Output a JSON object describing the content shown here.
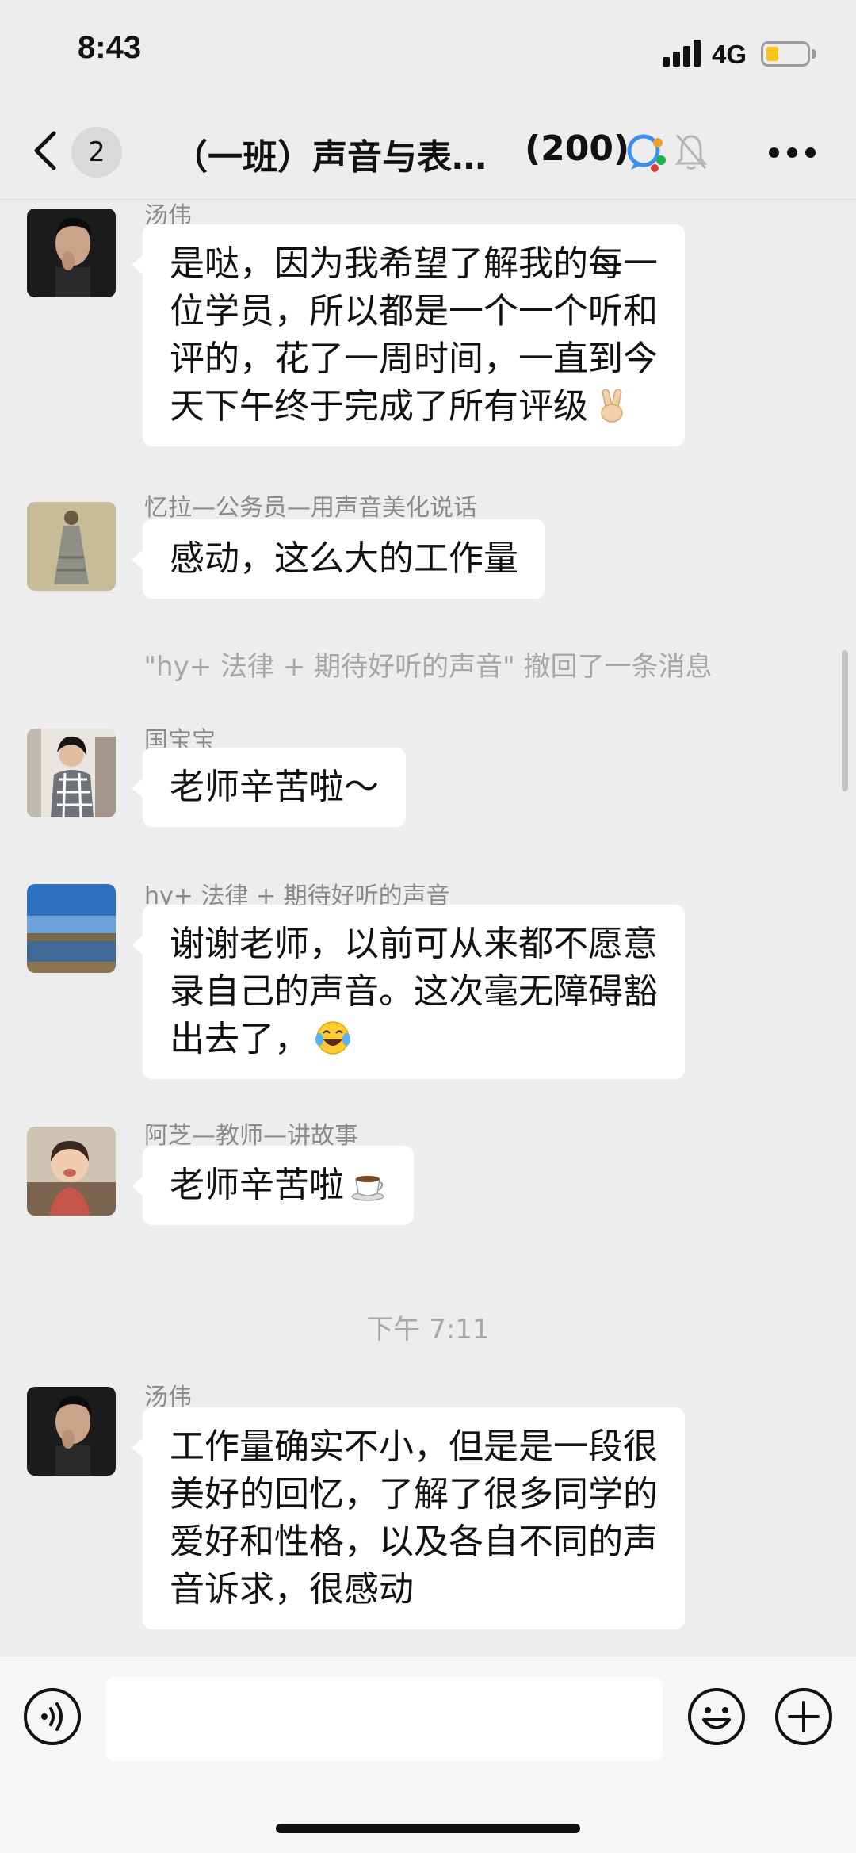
{
  "status_bar": {
    "time": "8:43",
    "network": "4G",
    "battery_level": 0.3,
    "battery_color": "#f5c518"
  },
  "nav": {
    "back_icon": "chevron-left-icon",
    "unread_count": "2",
    "title": "（一班）声音与表…",
    "member_count": "(200)",
    "group_icon": "group-chat-icon",
    "mute_icon": "bell-muted-icon",
    "more_icon": "more-dots-icon"
  },
  "messages": [
    {
      "sender": "汤伟",
      "avatar": "man-portrait",
      "lines": [
        "是哒，因为我希望了解我的每一",
        "位学员，所以都是一个一个听和",
        "评的，花了一周时间，一直到今",
        "天下午终于完成了所有评级"
      ],
      "emoji": "victory-hand-emoji"
    },
    {
      "sender": "忆拉—公务员—用声音美化说话",
      "avatar": "dress-photo",
      "lines": [
        "感动，这么大的工作量"
      ]
    },
    {
      "system": "\"hy+ 法律 + 期待好听的声音\" 撤回了一条消息"
    },
    {
      "sender": "国宝宝",
      "avatar": "woman-plaid",
      "lines": [
        "老师辛苦啦～"
      ]
    },
    {
      "sender": "hy+ 法律 + 期待好听的声音",
      "avatar": "lake-landscape",
      "lines": [
        "谢谢老师，以前可从来都不愿意",
        "录自己的声音。这次毫无障碍豁",
        "出去了，"
      ],
      "emoji": "tears-of-joy-emoji"
    },
    {
      "sender": "阿芝—教师—讲故事",
      "avatar": "child-photo",
      "lines": [
        "老师辛苦啦"
      ],
      "emoji": "coffee-emoji"
    },
    {
      "time": "下午 7:11"
    },
    {
      "sender": "汤伟",
      "avatar": "man-portrait",
      "lines": [
        "工作量确实不小，但是是一段很",
        "美好的回忆，了解了很多同学的",
        "爱好和性格，以及各自不同的声",
        "音诉求，很感动"
      ]
    }
  ],
  "input_bar": {
    "voice_icon": "voice-icon",
    "input_value": "",
    "emoji_icon": "emoji-face-icon",
    "plus_icon": "plus-circle-icon"
  },
  "colors": {
    "background": "#ededed",
    "bubble": "#ffffff",
    "meta_text": "#8a8a8a",
    "system_text": "#a7a7a7"
  }
}
